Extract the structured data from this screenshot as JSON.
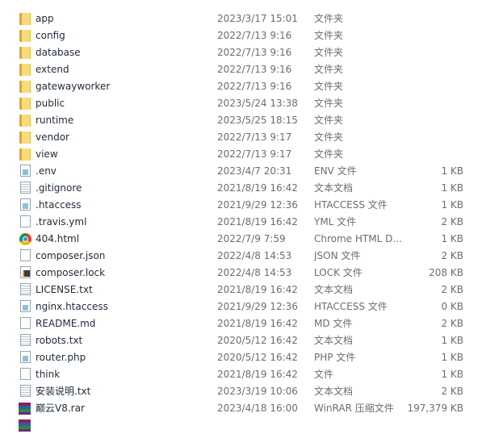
{
  "files": [
    {
      "name": "app",
      "date": "2023/3/17 15:01",
      "type": "文件夹",
      "size": "",
      "icon": "folder-icon"
    },
    {
      "name": "config",
      "date": "2022/7/13 9:16",
      "type": "文件夹",
      "size": "",
      "icon": "folder-icon"
    },
    {
      "name": "database",
      "date": "2022/7/13 9:16",
      "type": "文件夹",
      "size": "",
      "icon": "folder-icon"
    },
    {
      "name": "extend",
      "date": "2022/7/13 9:16",
      "type": "文件夹",
      "size": "",
      "icon": "folder-icon"
    },
    {
      "name": "gatewayworker",
      "date": "2022/7/13 9:16",
      "type": "文件夹",
      "size": "",
      "icon": "folder-icon"
    },
    {
      "name": "public",
      "date": "2023/5/24 13:38",
      "type": "文件夹",
      "size": "",
      "icon": "folder-icon"
    },
    {
      "name": "runtime",
      "date": "2023/5/25 18:15",
      "type": "文件夹",
      "size": "",
      "icon": "folder-icon"
    },
    {
      "name": "vendor",
      "date": "2022/7/13 9:17",
      "type": "文件夹",
      "size": "",
      "icon": "folder-icon"
    },
    {
      "name": "view",
      "date": "2022/7/13 9:17",
      "type": "文件夹",
      "size": "",
      "icon": "folder-icon"
    },
    {
      "name": ".env",
      "date": "2023/4/7 20:31",
      "type": "ENV 文件",
      "size": "1 KB",
      "icon": "config-file-icon"
    },
    {
      "name": ".gitignore",
      "date": "2021/8/19 16:42",
      "type": "文本文档",
      "size": "1 KB",
      "icon": "text-file-icon"
    },
    {
      "name": ".htaccess",
      "date": "2021/9/29 12:36",
      "type": "HTACCESS 文件",
      "size": "1 KB",
      "icon": "config-file-icon"
    },
    {
      "name": ".travis.yml",
      "date": "2021/8/19 16:42",
      "type": "YML 文件",
      "size": "2 KB",
      "icon": "blank-file-icon"
    },
    {
      "name": "404.html",
      "date": "2022/7/9 7:59",
      "type": "Chrome HTML D...",
      "size": "1 KB",
      "icon": "chrome-icon"
    },
    {
      "name": "composer.json",
      "date": "2022/4/8 14:53",
      "type": "JSON 文件",
      "size": "2 KB",
      "icon": "blank-file-icon"
    },
    {
      "name": "composer.lock",
      "date": "2022/4/8 14:53",
      "type": "LOCK 文件",
      "size": "208 KB",
      "icon": "sublime-file-icon"
    },
    {
      "name": "LICENSE.txt",
      "date": "2021/8/19 16:42",
      "type": "文本文档",
      "size": "2 KB",
      "icon": "text-file-icon"
    },
    {
      "name": "nginx.htaccess",
      "date": "2021/9/29 12:36",
      "type": "HTACCESS 文件",
      "size": "0 KB",
      "icon": "config-file-icon"
    },
    {
      "name": "README.md",
      "date": "2021/8/19 16:42",
      "type": "MD 文件",
      "size": "2 KB",
      "icon": "blank-file-icon"
    },
    {
      "name": "robots.txt",
      "date": "2020/5/12 16:42",
      "type": "文本文档",
      "size": "1 KB",
      "icon": "text-file-icon"
    },
    {
      "name": "router.php",
      "date": "2020/5/12 16:42",
      "type": "PHP 文件",
      "size": "1 KB",
      "icon": "config-file-icon"
    },
    {
      "name": "think",
      "date": "2021/8/19 16:42",
      "type": "文件",
      "size": "1 KB",
      "icon": "blank-file-icon"
    },
    {
      "name": "安装说明.txt",
      "date": "2023/3/19 10:06",
      "type": "文本文档",
      "size": "2 KB",
      "icon": "text-file-icon"
    },
    {
      "name": "巅云V8.rar",
      "date": "2023/4/18 16:00",
      "type": "WinRAR 压缩文件",
      "size": "197,379 KB",
      "icon": "winrar-icon"
    },
    {
      "name": "",
      "date": "",
      "type": "",
      "size": "",
      "icon": "winrar-icon"
    }
  ]
}
